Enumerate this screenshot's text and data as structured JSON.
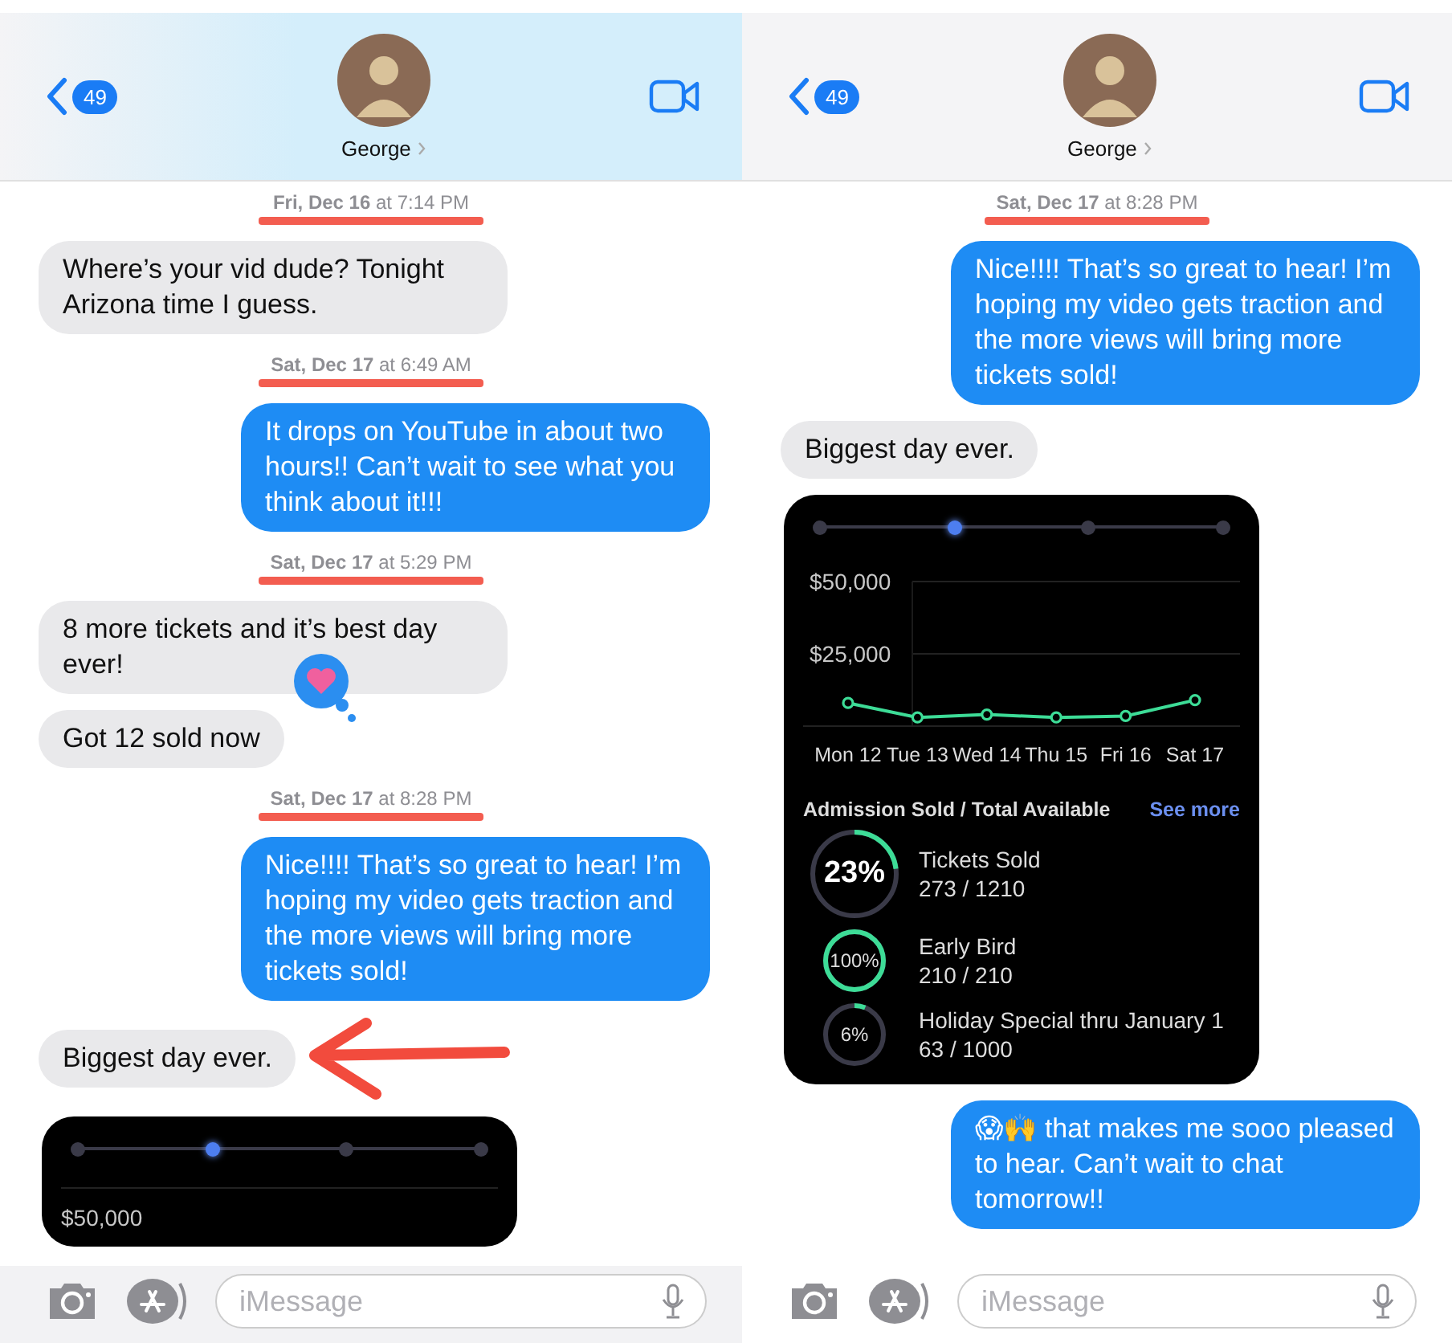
{
  "panels": [
    {
      "header": {
        "back_count": "49",
        "contact": "George"
      },
      "messages": [
        {
          "kind": "timestamp",
          "text": "**Fri, Dec 16** at 7:14 PM",
          "highlighted": true
        },
        {
          "kind": "received",
          "text": "Where’s your vid dude? Tonight Arizona time I guess."
        },
        {
          "kind": "timestamp",
          "text": "**Sat, Dec 17** at 6:49 AM",
          "highlighted": true
        },
        {
          "kind": "sent",
          "text": "It drops on YouTube in about two hours!! Can’t wait to see what you think about it!!!"
        },
        {
          "kind": "timestamp",
          "text": "**Sat, Dec 17** at 5:29 PM",
          "highlighted": true
        },
        {
          "kind": "received",
          "text": "8 more tickets and it’s best day ever!"
        },
        {
          "kind": "received",
          "text": "Got 12 sold now",
          "loved": true
        },
        {
          "kind": "timestamp",
          "text": "**Sat, Dec 17** at 8:28 PM",
          "highlighted": true
        },
        {
          "kind": "sent",
          "text": "Nice!!!! That’s so great to hear! I’m hoping my video gets traction and the more views will bring more tickets sold!"
        },
        {
          "kind": "received",
          "text": "Biggest day ever.",
          "annotated": true
        },
        {
          "kind": "card",
          "slider": [
            {
              "selected": false
            },
            {
              "selected": true
            },
            {
              "selected": false
            },
            {
              "selected": false
            }
          ],
          "axis_labels": [
            "$50,000"
          ]
        }
      ],
      "input": {
        "placeholder": "iMessage"
      }
    },
    {
      "header": {
        "back_count": "49",
        "contact": "George"
      },
      "messages": [
        {
          "kind": "timestamp",
          "text": "**Sat, Dec 17** at 8:28 PM",
          "highlighted": true
        },
        {
          "kind": "sent",
          "text": "Nice!!!! That’s so great to hear! I’m hoping my video gets traction and the more views will bring more tickets sold!"
        },
        {
          "kind": "received",
          "text": "Biggest day ever."
        },
        {
          "kind": "card",
          "slider": [
            {
              "selected": false
            },
            {
              "selected": true
            },
            {
              "selected": false
            },
            {
              "selected": false
            }
          ],
          "chart_data": {
            "type": "line",
            "categories": [
              "Mon 12",
              "Tue 13",
              "Wed 14",
              "Thu 15",
              "Fri 16",
              "Sat 17"
            ],
            "series": [
              {
                "color": "#3ddc97",
                "marker": "circle",
                "values": [
                  8000,
                  3000,
                  4000,
                  3000,
                  3500,
                  9000
                ]
              }
            ],
            "ylim": [
              0,
              50000
            ],
            "yticks": [
              {
                "value": 25000,
                "label": "$25,000"
              },
              {
                "value": 50000,
                "label": "$50,000"
              }
            ]
          },
          "stats_title": "Admission Sold / Total Available",
          "stats_link": "See more",
          "stats": [
            {
              "percent": "23%",
              "level": 0.23,
              "name": "Tickets Sold",
              "count": "273 / 1210"
            },
            {
              "percent": "100%",
              "level": 1,
              "name": "Early Bird",
              "count": "210 / 210"
            },
            {
              "percent": "6%",
              "level": 0.06,
              "name": "Holiday Special thru January 1",
              "count": "63 / 1000"
            }
          ]
        },
        {
          "kind": "sent",
          "text": "😱🙌 that makes me sooo pleased to hear. Can’t wait to chat tomorrow!!"
        }
      ],
      "input": {
        "placeholder": "iMessage"
      }
    }
  ]
}
